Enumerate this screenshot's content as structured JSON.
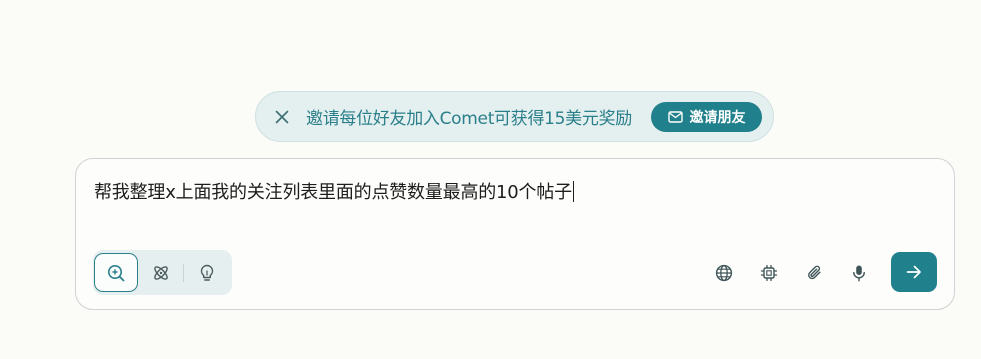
{
  "banner": {
    "message": "邀请每位好友加入Comet可获得15美元奖励",
    "invite_button_label": "邀请朋友",
    "close_icon": "close-icon",
    "mail_icon": "mail-icon"
  },
  "composer": {
    "query": "帮我整理x上面我的关注列表里面的点赞数量最高的10个帖子",
    "modes": [
      {
        "name": "search",
        "icon": "search-zoom-icon",
        "active": true
      },
      {
        "name": "research",
        "icon": "atom-icon",
        "active": false
      },
      {
        "name": "labs",
        "icon": "lightbulb-icon",
        "active": false
      }
    ],
    "tools": [
      "globe-icon",
      "chip-icon",
      "paperclip-icon",
      "microphone-icon"
    ],
    "submit_icon": "arrow-right-icon"
  },
  "colors": {
    "accent": "#20808c",
    "accent_text": "#2a7f8a",
    "banner_bg": "#e4efef",
    "page_bg": "#fbfbf7"
  }
}
